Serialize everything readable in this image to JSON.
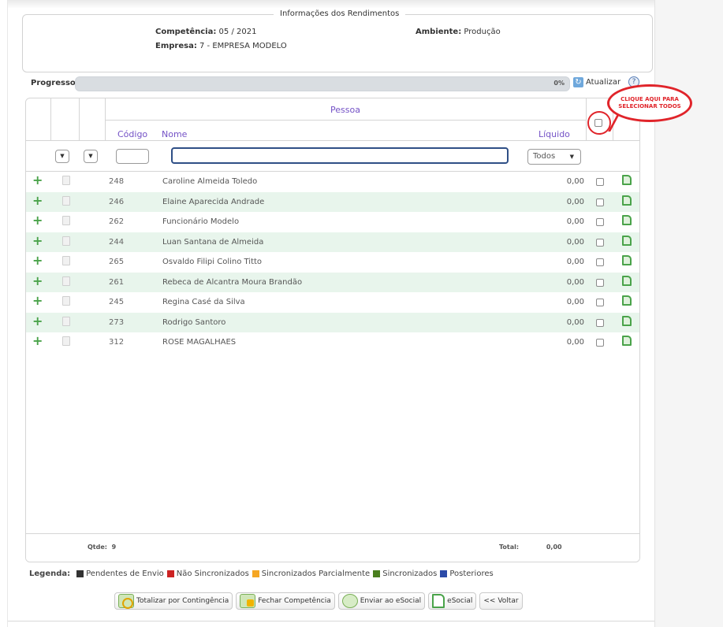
{
  "info": {
    "title": "Informações dos Rendimentos",
    "competencia_label": "Competência:",
    "competencia_value": "05 / 2021",
    "ambiente_label": "Ambiente:",
    "ambiente_value": "Produção",
    "empresa_label": "Empresa:",
    "empresa_value": "7 - EMPRESA MODELO"
  },
  "progress": {
    "label": "Progresso:",
    "percent_text": "0%",
    "fraction": 0.0,
    "refresh_label": "Atualizar"
  },
  "grid": {
    "group_header": "Pessoa",
    "columns": {
      "codigo": "Código",
      "nome": "Nome",
      "liquido": "Líquido"
    },
    "filter": {
      "status_selected": "Todos"
    },
    "rows": [
      {
        "code": "248",
        "name": "Caroline Almeida Toledo",
        "liquido": "0,00"
      },
      {
        "code": "246",
        "name": "Elaine Aparecida Andrade",
        "liquido": "0,00"
      },
      {
        "code": "262",
        "name": "Funcionário Modelo",
        "liquido": "0,00"
      },
      {
        "code": "244",
        "name": "Luan Santana de Almeida",
        "liquido": "0,00"
      },
      {
        "code": "265",
        "name": "Osvaldo Filipi Colino Titto",
        "liquido": "0,00"
      },
      {
        "code": "261",
        "name": "Rebeca de Alcantra Moura Brandão",
        "liquido": "0,00"
      },
      {
        "code": "245",
        "name": "Regina Casé da Silva",
        "liquido": "0,00"
      },
      {
        "code": "273",
        "name": "Rodrigo Santoro",
        "liquido": "0,00"
      },
      {
        "code": "312",
        "name": "ROSE MAGALHAES",
        "liquido": "0,00"
      }
    ],
    "footer": {
      "qtde_label": "Qtde:",
      "qtde_value": "9",
      "total_label": "Total:",
      "total_value": "0,00"
    }
  },
  "callout": {
    "text": "CLIQUE AQUI PARA SELECIONAR TODOS"
  },
  "legend": {
    "title": "Legenda:",
    "items": [
      {
        "label": "Pendentes de Envio",
        "color": "#333333"
      },
      {
        "label": "Não Sincronizados",
        "color": "#cc2222"
      },
      {
        "label": "Sincronizados Parcialmente",
        "color": "#f5a623"
      },
      {
        "label": "Sincronizados",
        "color": "#4a7f1f"
      },
      {
        "label": "Posteriores",
        "color": "#2b4aa8"
      }
    ]
  },
  "actions": {
    "totalizar": "Totalizar por Contingência",
    "fechar": "Fechar Competência",
    "enviar": "Enviar ao eSocial",
    "esocial": "eSocial",
    "voltar": "<< Voltar"
  }
}
